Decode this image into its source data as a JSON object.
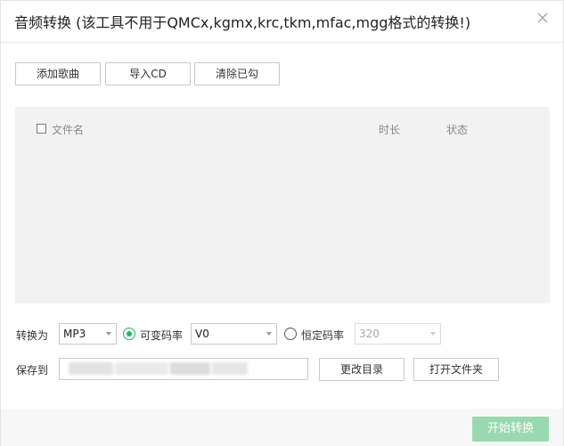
{
  "dialog": {
    "title": "音频转换 (该工具不用于QMCx,kgmx,krc,tkm,mfac,mgg格式的转换!)"
  },
  "toolbar": {
    "add_song": "添加歌曲",
    "import_cd": "导入CD",
    "clear_checked": "清除已勾"
  },
  "list": {
    "columns": {
      "filename": "文件名",
      "duration": "时长",
      "status": "状态"
    },
    "rows": []
  },
  "convert": {
    "label": "转换为",
    "format_value": "MP3",
    "vbr_label": "可变码率",
    "vbr_value": "V0",
    "cbr_label": "恒定码率",
    "cbr_value": "320",
    "selected_mode": "vbr"
  },
  "save": {
    "label": "保存到",
    "path_value": "",
    "change_dir": "更改目录",
    "open_folder": "打开文件夹"
  },
  "footer": {
    "start": "开始转换"
  },
  "colors": {
    "accent": "#27b35f",
    "start_disabled": "#9ad9b0",
    "list_bg": "#f2f2f2"
  },
  "icons": {
    "close": "close-icon",
    "checkbox": "checkbox-icon",
    "dropdown": "chevron-down-icon"
  }
}
